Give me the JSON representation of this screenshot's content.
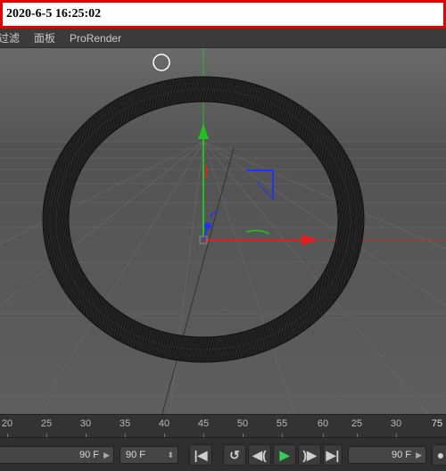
{
  "screenshot_timestamp": "2020-6-5 16:25:02",
  "menu": {
    "items": [
      "过滤",
      "面板",
      "ProRender"
    ]
  },
  "timeline": {
    "ticks": [
      "20",
      "25",
      "30",
      "35",
      "40",
      "45",
      "50",
      "55",
      "60",
      "25",
      "30"
    ],
    "end_marker": "75"
  },
  "transport": {
    "start_frame": "90 F",
    "current_frame": "90 F",
    "end_frame": "90 F",
    "buttons": [
      "goto-start",
      "loop",
      "step-back",
      "play",
      "step-forward",
      "goto-end"
    ]
  },
  "colors": {
    "x_axis": "#e02020",
    "y_axis": "#22c022",
    "z_axis": "#2233ee",
    "viewport_bg": "#5b5b5b",
    "play_green": "#32d05a"
  },
  "icons": {
    "goto_start": "skip-to-start-icon",
    "loop": "loop-icon",
    "step_back": "step-back-icon",
    "play": "play-icon",
    "step_forward": "step-forward-icon",
    "goto_end": "skip-to-end-icon"
  }
}
